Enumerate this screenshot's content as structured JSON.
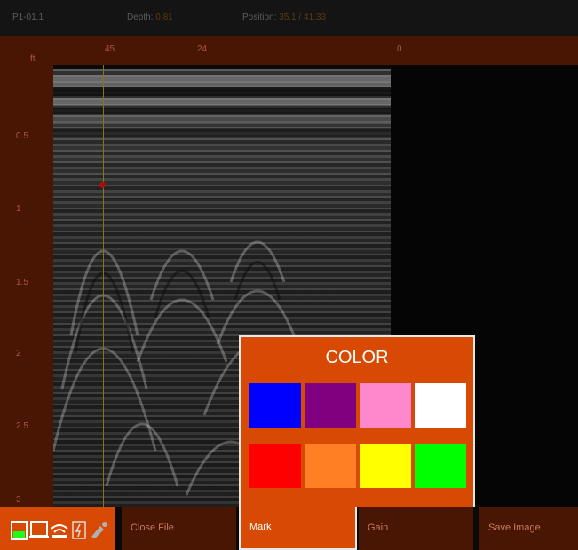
{
  "topbar": {
    "file": "P1-01.1",
    "depth_label": "Depth:",
    "depth_value": "0.81",
    "position_label": "Position:",
    "position_value": "35.1 / 41.33"
  },
  "ruler_h": {
    "unit": "ft",
    "ticks": [
      "45",
      "24",
      "0"
    ]
  },
  "ruler_v": {
    "ticks": [
      "0.5",
      "1",
      "1.5",
      "2",
      "2.5",
      "3"
    ]
  },
  "color_picker": {
    "title": "COLOR",
    "swatches": [
      "#0000ff",
      "#800080",
      "#ff88cc",
      "#ffffff",
      "#ff0000",
      "#ff7f24",
      "#ffff00",
      "#00ff00"
    ]
  },
  "toolbar": {
    "close_file": "Close File",
    "mark": "Mark",
    "gain": "Gain",
    "save_image": "Save Image"
  },
  "status_icons": [
    "battery-icon",
    "tablet-icon",
    "wifi-icon",
    "card-icon",
    "gps-icon"
  ]
}
